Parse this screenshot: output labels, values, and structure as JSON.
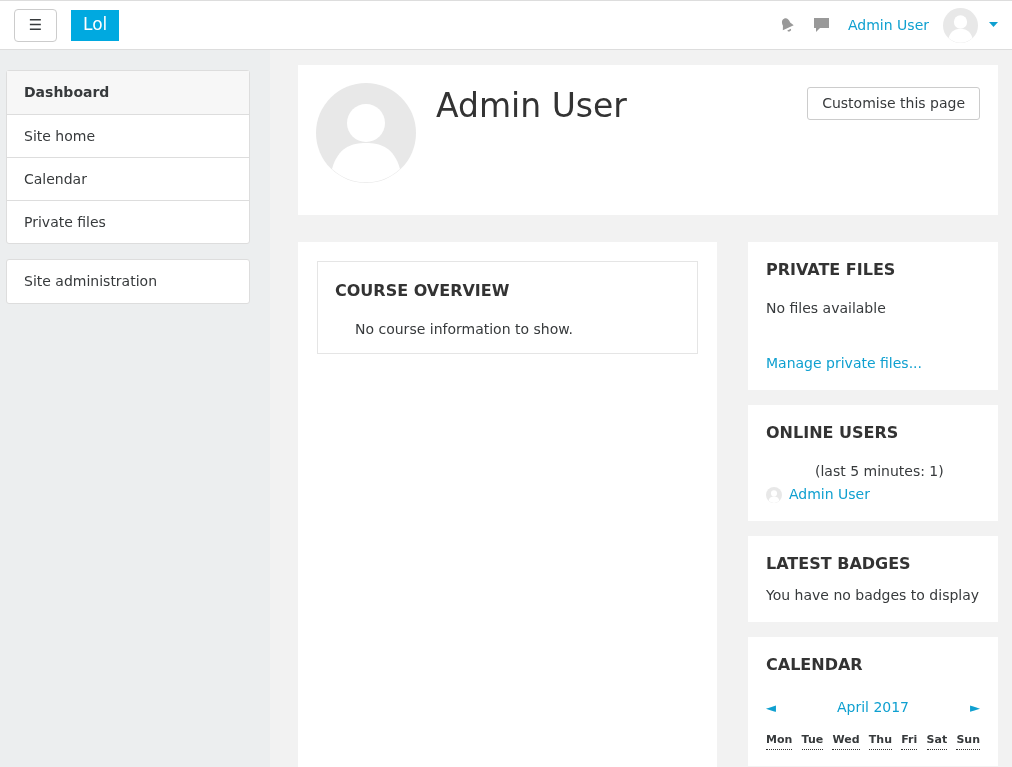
{
  "header": {
    "menu_button": "☰",
    "logo": "Lol",
    "user_name": "Admin User"
  },
  "sidebar": {
    "groups": [
      [
        {
          "label": "Dashboard",
          "selected": true
        },
        {
          "label": "Site home",
          "selected": false
        },
        {
          "label": "Calendar",
          "selected": false
        },
        {
          "label": "Private files",
          "selected": false
        }
      ],
      [
        {
          "label": "Site administration",
          "selected": false
        }
      ]
    ]
  },
  "profile": {
    "name": "Admin User",
    "customise_button": "Customise this page"
  },
  "course_overview": {
    "title": "COURSE OVERVIEW",
    "message": "No course information to show."
  },
  "private_files": {
    "title": "PRIVATE FILES",
    "message": "No files available",
    "link": "Manage private files..."
  },
  "online_users": {
    "title": "ONLINE USERS",
    "summary": "(last 5 minutes: 1)",
    "users": [
      "Admin User"
    ]
  },
  "latest_badges": {
    "title": "LATEST BADGES",
    "message": "You have no badges to display"
  },
  "calendar": {
    "title": "CALENDAR",
    "prev": "◄",
    "month": "April 2017",
    "next": "►",
    "weekdays": [
      "Mon",
      "Tue",
      "Wed",
      "Thu",
      "Fri",
      "Sat",
      "Sun"
    ]
  }
}
